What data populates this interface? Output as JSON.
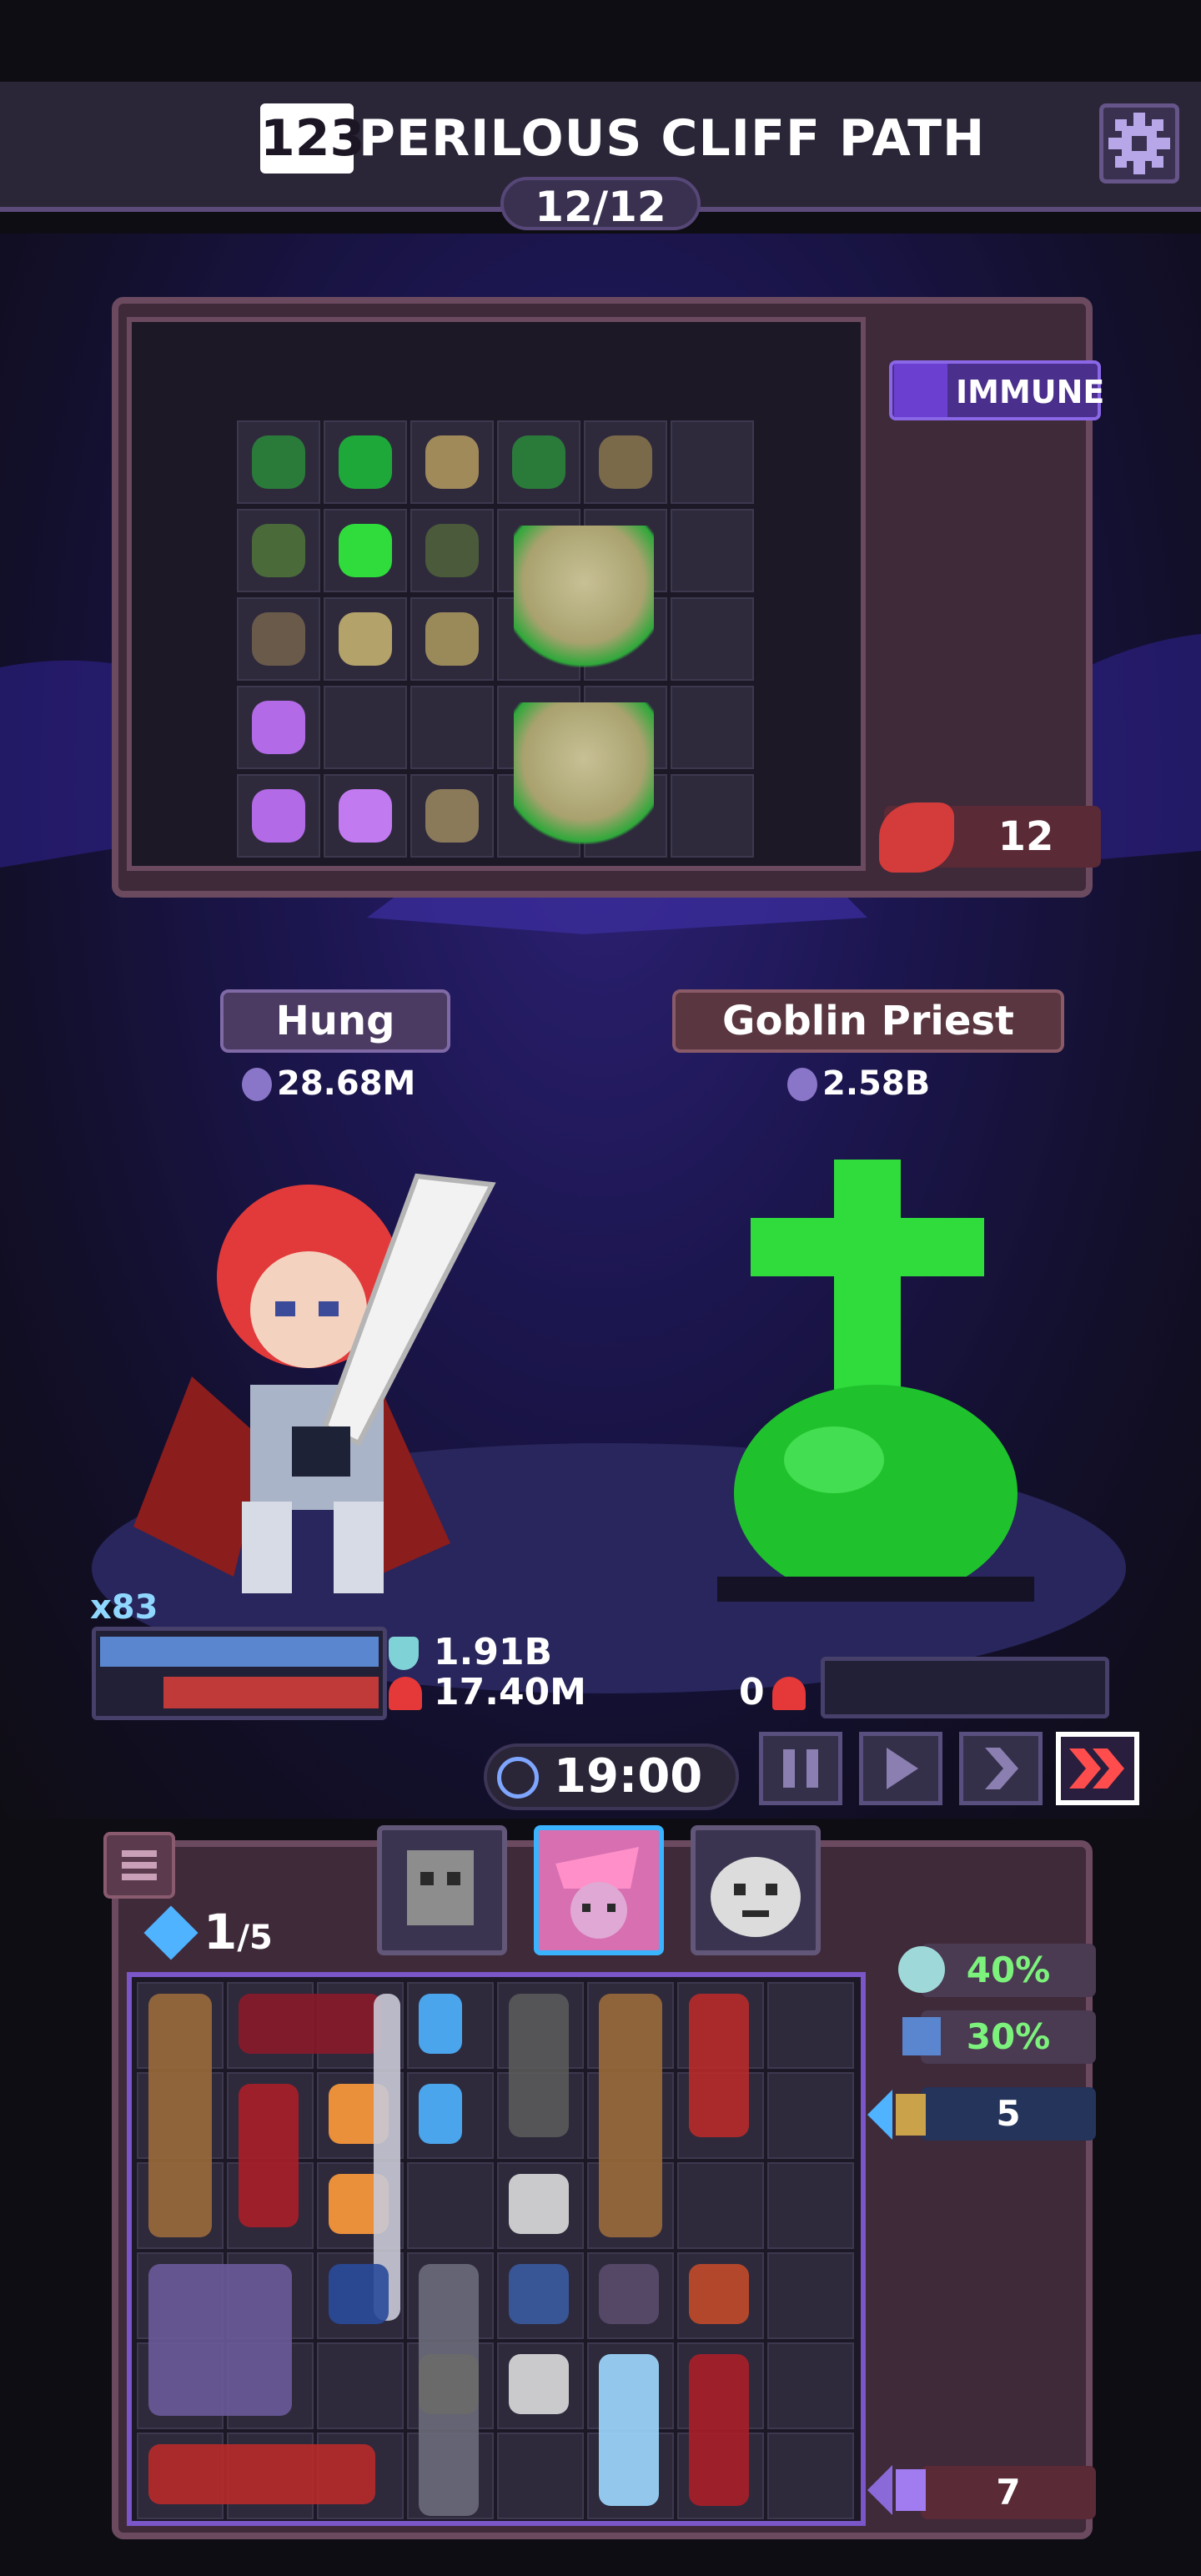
{
  "header": {
    "level_badge": "123",
    "stage_title": "PERILOUS CLIFF PATH",
    "progress": "12/12",
    "settings_icon": "gear-icon"
  },
  "enemy_bag": {
    "status_badge": "IMMUNE",
    "counter_value": "12",
    "items": [
      "dagger",
      "green-pouch",
      "ring",
      "dagger",
      "staff",
      "staff",
      "skull",
      "ring",
      "staff",
      "staff",
      "flower",
      "skull",
      "flower",
      "flower",
      "sack"
    ]
  },
  "combatants": {
    "hero": {
      "name": "Hung",
      "power": "28.68M",
      "multiplier": "x83",
      "armor": "1.91B",
      "hp": "17.40M"
    },
    "enemy": {
      "name": "Goblin Priest",
      "power": "2.58B",
      "hp": "0"
    }
  },
  "controls": {
    "timer": "19:00",
    "speed_buttons": [
      "pause",
      "play",
      "fast",
      "fastest"
    ],
    "active_speed": "fastest"
  },
  "player_bag": {
    "gems": "1",
    "gems_max": "/5",
    "stats": {
      "crit": "40%",
      "defense": "30%",
      "attack_count": "5",
      "enemy_count": "7"
    },
    "tabs": [
      "knight",
      "witch",
      "ghost"
    ]
  },
  "colors": {
    "background": "#0f0d14",
    "panel": "#3f2a3a",
    "accent_purple": "#7a56c8",
    "hp_red": "#c03a3a",
    "shield_blue": "#5a86d0",
    "stat_green": "#7cf27c",
    "enemy_green": "#2fdc3c"
  }
}
